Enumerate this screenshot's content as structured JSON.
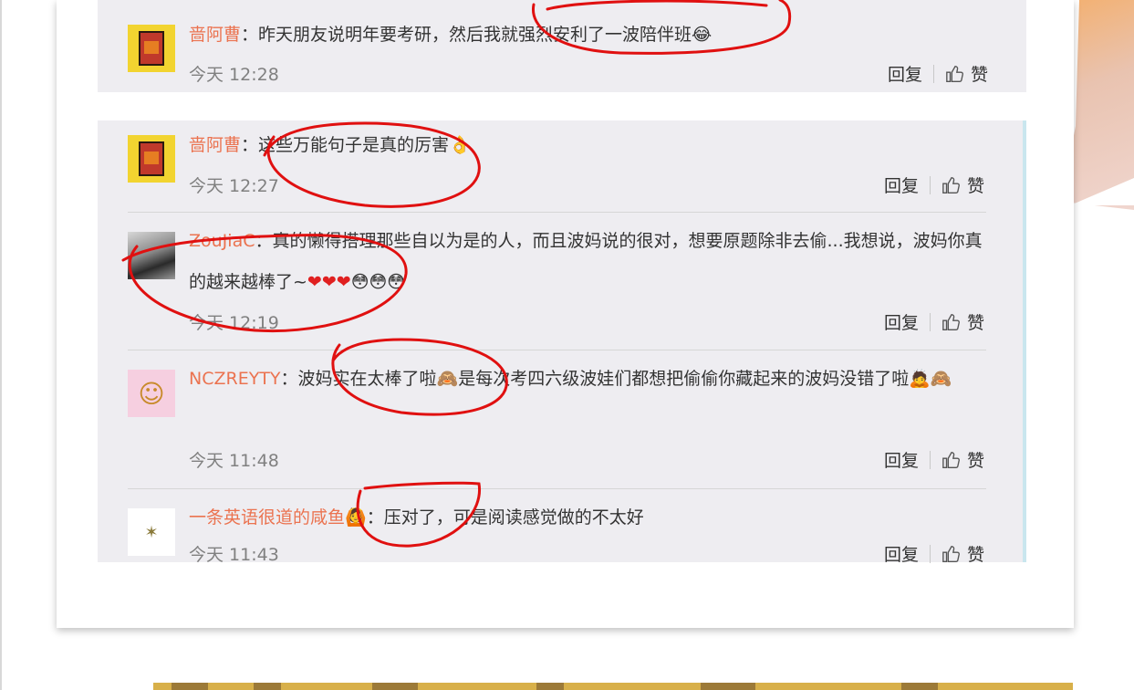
{
  "comments": [
    {
      "username": "啬阿曹",
      "separator": "：",
      "text": "昨天朋友说明年要考研，然后我就强烈安利了一波陪伴班",
      "emoji": "😂",
      "time": "今天 12:28",
      "reply_label": "回复",
      "like_label": "赞",
      "avatar_icon": "book-avatar-icon"
    },
    {
      "username": "啬阿曹",
      "separator": "：",
      "text": "这些万能句子是真的厉害",
      "emoji": "👌",
      "time": "今天 12:27",
      "reply_label": "回复",
      "like_label": "赞",
      "avatar_icon": "book-avatar-icon"
    },
    {
      "username": "ZouJiaC",
      "separator": "：",
      "text": "真的懒得搭理那些自以为是的人，而且波妈说的很对，想要原题除非去偷...我想说，波妈你真的越来越棒了~",
      "emoji_hearts": "❤❤❤",
      "emoji_faces": "😳😳😳",
      "time": "今天 12:19",
      "reply_label": "回复",
      "like_label": "赞",
      "avatar_icon": "girl-photo-avatar-icon"
    },
    {
      "username": "NCZREYTY",
      "separator": "：",
      "text_part1": "波妈实在太棒了啦",
      "emoji1": "🙈",
      "text_part2": "是每次考四六级波娃们都想把偷偷你藏起来的波妈没错了啦",
      "emoji2": "🙇",
      "emoji3": "🙈",
      "time": "今天 11:48",
      "reply_label": "回复",
      "like_label": "赞",
      "avatar_icon": "cartoon-avatar-icon"
    },
    {
      "username": "一条英语很道的咸鱼",
      "badge_emoji": "🙆",
      "separator": "：",
      "text": "压对了，可是阅读感觉做的不太好",
      "time": "今天 11:43",
      "reply_label": "回复",
      "like_label": "赞",
      "avatar_icon": "fish-avatar-icon"
    }
  ],
  "colors": {
    "username": "#eb7350",
    "text": "#333333",
    "time": "#808080",
    "panel_bg": "#eeedf1",
    "annotation": "#e01010"
  },
  "annotations": "red-hand-drawn-circle-marks"
}
